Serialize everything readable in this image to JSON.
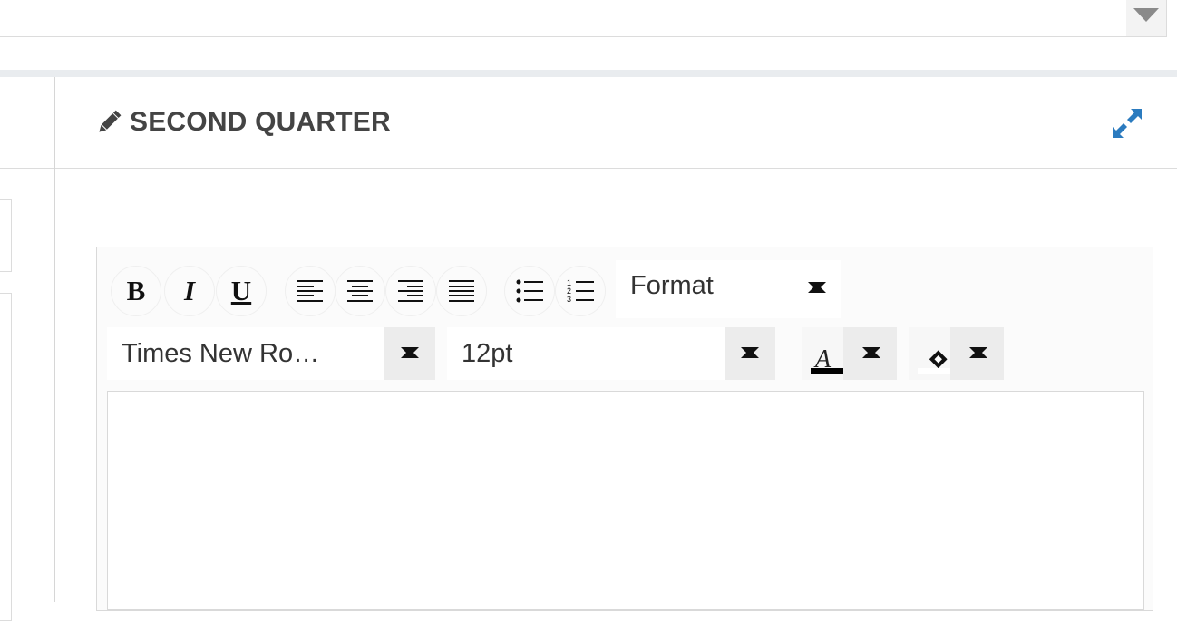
{
  "panel": {
    "title": "SECOND QUARTER"
  },
  "icons": {
    "title_icon": "pencil-icon",
    "expand": "expand-icon",
    "select_arrow": "chevron-down-icon"
  },
  "toolbar": {
    "bold": "B",
    "italic": "I",
    "underline": "U",
    "format_label": "Format",
    "font_family": "Times New Ro…",
    "font_size": "12pt",
    "text_color": "#000000",
    "highlight_color": "#ffffff"
  },
  "colors": {
    "accent": "#2b7bbf"
  }
}
